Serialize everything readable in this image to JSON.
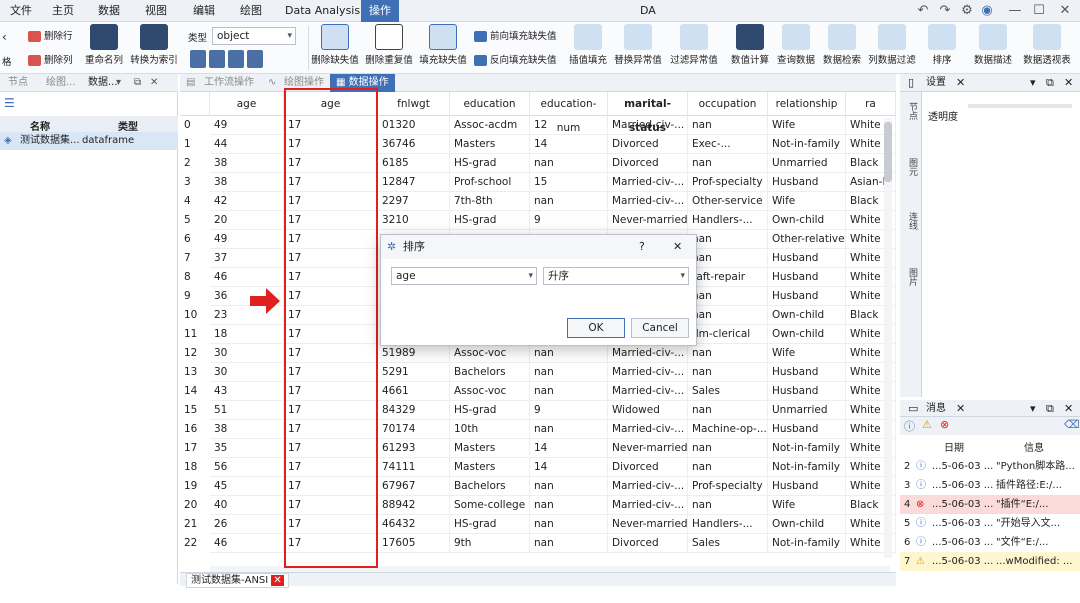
{
  "app_title": "DA",
  "menubar": [
    "文件",
    "主页",
    "数据",
    "视图",
    "编辑",
    "绘图",
    "Data Analysis",
    "操作"
  ],
  "ribbon": {
    "row_ops": [
      "删除行",
      "删除列"
    ],
    "rename": "重命名列",
    "to_index": "转换为索引",
    "type_label": "类型",
    "type_value": "object",
    "big_buttons": [
      "删除缺失值",
      "删除重复值",
      "填充缺失值"
    ],
    "fill_forward": "前向填充缺失值",
    "fill_backward": "反向填充缺失值",
    "more_buttons": [
      "插值填充",
      "替换异常值",
      "过滤异常值",
      "数值计算",
      "查询数据",
      "数据检索",
      "列数据过滤",
      "排序",
      "数据描述",
      "数据透视表"
    ],
    "left_cut": "格"
  },
  "left_tabs": [
    "节点",
    "绘图...",
    "数据..."
  ],
  "left_panel": {
    "headers": [
      "名称",
      "类型"
    ],
    "row": {
      "name": "测试数据集...",
      "type": "dataframe"
    }
  },
  "doc_tabs": [
    "工作流操作",
    "绘图操作",
    "数据操作"
  ],
  "grid": {
    "columns": [
      "age",
      "age",
      "fnlwgt",
      "education",
      "education-num",
      "marital-status",
      "occupation",
      "relationship",
      "ra"
    ],
    "rows": [
      [
        "0",
        "49",
        "17",
        "01320",
        "Assoc-acdm",
        "12",
        "Married-civ-...",
        "nan",
        "Wife",
        "White"
      ],
      [
        "1",
        "44",
        "17",
        "36746",
        "Masters",
        "14",
        "Divorced",
        "Exec-...",
        "Not-in-family",
        "White"
      ],
      [
        "2",
        "38",
        "17",
        "6185",
        "HS-grad",
        "nan",
        "Divorced",
        "nan",
        "Unmarried",
        "Black"
      ],
      [
        "3",
        "38",
        "17",
        "12847",
        "Prof-school",
        "15",
        "Married-civ-...",
        "Prof-specialty",
        "Husband",
        "Asian-P"
      ],
      [
        "4",
        "42",
        "17",
        "2297",
        "7th-8th",
        "nan",
        "Married-civ-...",
        "Other-service",
        "Wife",
        "Black"
      ],
      [
        "5",
        "20",
        "17",
        "3210",
        "HS-grad",
        "9",
        "Never-married",
        "Handlers-...",
        "Own-child",
        "White"
      ],
      [
        "6",
        "49",
        "17",
        "",
        "",
        "",
        "",
        "nan",
        "Other-relative",
        "White"
      ],
      [
        "7",
        "37",
        "17",
        "",
        "",
        "",
        "",
        "nan",
        "Husband",
        "White"
      ],
      [
        "8",
        "46",
        "17",
        "",
        "",
        "",
        "",
        "raft-repair",
        "Husband",
        "White"
      ],
      [
        "9",
        "36",
        "17",
        "",
        "",
        "",
        "",
        "nan",
        "Husband",
        "White"
      ],
      [
        "10",
        "23",
        "17",
        "",
        "",
        "",
        "",
        "nan",
        "Own-child",
        "Black"
      ],
      [
        "11",
        "18",
        "17",
        "",
        "",
        "",
        "",
        "dm-clerical",
        "Own-child",
        "White"
      ],
      [
        "12",
        "30",
        "17",
        "51989",
        "Assoc-voc",
        "nan",
        "Married-civ-...",
        "nan",
        "Wife",
        "White"
      ],
      [
        "13",
        "30",
        "17",
        "5291",
        "Bachelors",
        "nan",
        "Married-civ-...",
        "nan",
        "Husband",
        "White"
      ],
      [
        "14",
        "43",
        "17",
        "4661",
        "Assoc-voc",
        "nan",
        "Married-civ-...",
        "Sales",
        "Husband",
        "White"
      ],
      [
        "15",
        "51",
        "17",
        "84329",
        "HS-grad",
        "9",
        "Widowed",
        "nan",
        "Unmarried",
        "White"
      ],
      [
        "16",
        "38",
        "17",
        "70174",
        "10th",
        "nan",
        "Married-civ-...",
        "Machine-op-...",
        "Husband",
        "White"
      ],
      [
        "17",
        "35",
        "17",
        "61293",
        "Masters",
        "14",
        "Never-married",
        "nan",
        "Not-in-family",
        "White"
      ],
      [
        "18",
        "56",
        "17",
        "74111",
        "Masters",
        "14",
        "Divorced",
        "nan",
        "Not-in-family",
        "White"
      ],
      [
        "19",
        "45",
        "17",
        "67967",
        "Bachelors",
        "nan",
        "Married-civ-...",
        "Prof-specialty",
        "Husband",
        "White"
      ],
      [
        "20",
        "40",
        "17",
        "88942",
        "Some-college",
        "nan",
        "Married-civ-...",
        "nan",
        "Wife",
        "Black"
      ],
      [
        "21",
        "26",
        "17",
        "46432",
        "HS-grad",
        "nan",
        "Never-married",
        "Handlers-...",
        "Own-child",
        "White"
      ],
      [
        "22",
        "46",
        "17",
        "17605",
        "9th",
        "nan",
        "Divorced",
        "Sales",
        "Not-in-family",
        "White"
      ]
    ]
  },
  "bottom_tab": "测试数据集-ANSI",
  "dialog": {
    "title": "排序",
    "help": "?",
    "close": "✕",
    "column_value": "age",
    "order_value": "升序",
    "ok": "OK",
    "cancel": "Cancel"
  },
  "settings": {
    "tab": "设置",
    "opacity_label": "透明度",
    "vertical_labels": [
      "节点",
      "图元",
      "连线",
      "图片"
    ]
  },
  "messages": {
    "tab": "消息",
    "headers": [
      "日期",
      "信息"
    ],
    "rows": [
      {
        "n": "2",
        "level": "info",
        "date": "...5-06-03 ...",
        "text": "\"Python脚本路..."
      },
      {
        "n": "3",
        "level": "info",
        "date": "...5-06-03 ...",
        "text": "插件路径:E:/..."
      },
      {
        "n": "4",
        "level": "error",
        "date": "...5-06-03 ...",
        "text": "\"插件“E:/..."
      },
      {
        "n": "5",
        "level": "info",
        "date": "...5-06-03 ...",
        "text": "\"开始导入文..."
      },
      {
        "n": "6",
        "level": "info",
        "date": "...5-06-03 ...",
        "text": "\"文件“E:/..."
      },
      {
        "n": "7",
        "level": "warn",
        "date": "...5-06-03 ...",
        "text": "...wModified: ..."
      }
    ]
  },
  "colors": {
    "accent": "#3f6fb5",
    "highlight": "#e0201f",
    "error_row": "#fbdada",
    "warn_row": "#fdf6cf"
  }
}
